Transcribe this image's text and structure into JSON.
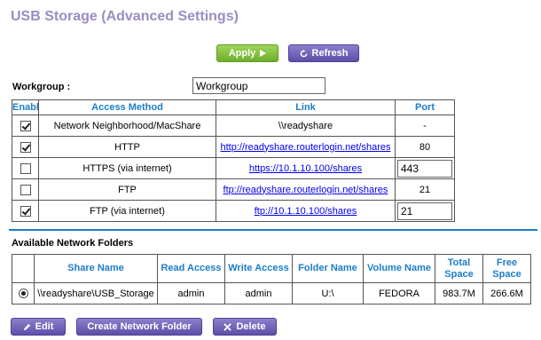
{
  "page": {
    "title": "USB Storage (Advanced Settings)"
  },
  "toolbar": {
    "apply_label": "Apply",
    "refresh_label": "Refresh"
  },
  "workgroup": {
    "label": "Workgroup :",
    "value": "Workgroup"
  },
  "access": {
    "headers": [
      "Enable",
      "Access Method",
      "Link",
      "Port"
    ],
    "rows": [
      {
        "enabled": true,
        "method": "Network Neighborhood/MacShare",
        "link": "\\\\readyshare",
        "link_is_url": false,
        "port": "-",
        "port_editable": false
      },
      {
        "enabled": true,
        "method": "HTTP",
        "link": "http://readyshare.routerlogin.net/shares",
        "link_is_url": true,
        "port": "80",
        "port_editable": false
      },
      {
        "enabled": false,
        "method": "HTTPS (via internet)",
        "link": "https://10.1.10.100/shares",
        "link_is_url": true,
        "port": "443",
        "port_editable": true
      },
      {
        "enabled": false,
        "method": "FTP",
        "link": "ftp://readyshare.routerlogin.net/shares",
        "link_is_url": true,
        "port": "21",
        "port_editable": false
      },
      {
        "enabled": true,
        "method": "FTP (via internet)",
        "link": "ftp://10.1.10.100/shares",
        "link_is_url": true,
        "port": "21",
        "port_editable": true
      }
    ]
  },
  "folders": {
    "section_title": "Available Network Folders",
    "headers": [
      "",
      "Share Name",
      "Read Access",
      "Write Access",
      "Folder Name",
      "Volume Name",
      "Total Space",
      "Free Space"
    ],
    "rows": [
      {
        "selected": true,
        "share_name": "\\\\readyshare\\USB_Storage",
        "read_access": "admin",
        "write_access": "admin",
        "folder_name": "U:\\",
        "volume_name": "FEDORA",
        "total_space": "983.7M",
        "free_space": "266.6M"
      }
    ]
  },
  "actions": {
    "edit_label": "Edit",
    "create_label": "Create Network Folder",
    "delete_label": "Delete"
  },
  "colors": {
    "title": "#9b8cc4",
    "header_text": "#1a7ec8",
    "apply_button": "#7cbd38",
    "purple_button": "#6a5cb5",
    "link": "#0000ee"
  }
}
